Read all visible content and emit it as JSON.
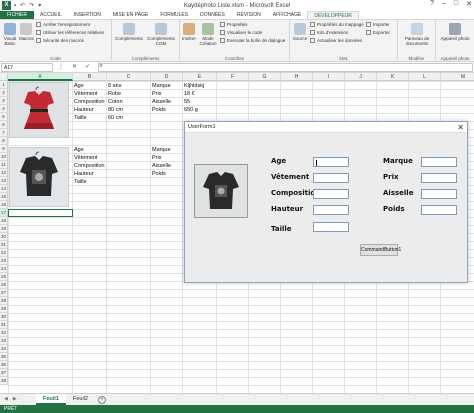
{
  "window": {
    "title": "Kaydéphoto Liste.xlsm - Microsoft Excel",
    "app_icon": "X",
    "controls": [
      "?",
      "–",
      "□",
      "✕"
    ],
    "qat": [
      "↶",
      "↷",
      "▾"
    ]
  },
  "tabs": [
    "FICHIER",
    "ACCUEIL",
    "INSERTION",
    "MISE EN PAGE",
    "FORMULES",
    "DONNÉES",
    "RÉVISION",
    "AFFICHAGE",
    "DÉVELOPPEUR"
  ],
  "active_tab": "DÉVELOPPEUR",
  "ribbon": {
    "code": {
      "name": "Code",
      "visual_basic": "Visual Basic",
      "macros": "Macros",
      "small": [
        "Arrêter l'enregistrement",
        "Utiliser les références relatives",
        "Sécurité des macros"
      ]
    },
    "complements": {
      "name": "Compléments",
      "btn1": "Compléments",
      "btn2": "Compléments COM"
    },
    "controles": {
      "name": "Contrôles",
      "inserer": "Insérer",
      "mode": "Mode Création",
      "small": [
        "Propriétés",
        "Visualiser le code",
        "Exécuter la boîte de dialogue"
      ]
    },
    "xml": {
      "name": "XML",
      "source": "Source",
      "small1": [
        "Propriétés du mappage",
        "Kits d'extension",
        "Actualiser les données"
      ],
      "small2": [
        "Importer",
        "Exporter"
      ]
    },
    "modifier": {
      "name": "Modifier",
      "btn": "Panneau de documents"
    },
    "appareil": {
      "name": "Appareil photo",
      "btn": "Appareil photo"
    }
  },
  "formula_bar": {
    "namebox": "A17",
    "buttons": [
      "⋮",
      "✕",
      "✓",
      "fx"
    ],
    "value": ""
  },
  "columns": [
    "A",
    "B",
    "C",
    "D",
    "E",
    "F",
    "G",
    "H",
    "I",
    "J",
    "K",
    "L",
    "M"
  ],
  "rows": [
    "1",
    "2",
    "3",
    "4",
    "5",
    "6",
    "7",
    "8",
    "9",
    "10",
    "11",
    "12",
    "13",
    "14",
    "15",
    "16",
    "17",
    "18",
    "19",
    "20",
    "21",
    "22",
    "23",
    "24",
    "25",
    "26",
    "27",
    "28",
    "29",
    "30",
    "31",
    "32",
    "33",
    "34",
    "35",
    "36",
    "37",
    "38"
  ],
  "cells": {
    "b1": "Age",
    "c1": "8 ans",
    "d1": "Marque",
    "e1": "Kljhldskj",
    "b2": "Vêtement",
    "c2": "Robe",
    "d2": "Prix",
    "e2": "18 €",
    "b3": "Composition",
    "c3": "Coton",
    "d3": "Aisselle",
    "e3": "55",
    "b4": "Hauteur",
    "c4": "80 cm",
    "d4": "Poids",
    "e4": "650 g",
    "b5": "Taille",
    "c5": "60 cm",
    "b10": "Age",
    "d10": "Marque",
    "b11": "Vêtement",
    "d11": "Prix",
    "b12": "Composition",
    "d12": "Aisselle",
    "b13": "Hauteur",
    "d13": "Poids",
    "b14": "Taille"
  },
  "sheets": [
    "Feuil1",
    "Feuil2"
  ],
  "active_sheet": "Feuil1",
  "status": "PRÊT",
  "userform": {
    "title": "UserForm1",
    "labels": {
      "age": "Age",
      "vetement": "Vêtement",
      "composition": "Composition",
      "hauteur": "Hauteur",
      "taille": "Taille",
      "marque": "Marque",
      "prix": "Prix",
      "aisselle": "Aisselle",
      "poids": "Poids"
    },
    "fields": {
      "age": "",
      "vetement": "",
      "composition": "",
      "hauteur": "",
      "taille": "",
      "marque": "",
      "prix": "",
      "aisselle": "",
      "poids": ""
    },
    "button": "CommandButton1"
  },
  "colors": {
    "accent": "#217346",
    "dress_red": "#c42a33",
    "black_top": "#2a2a2a"
  }
}
